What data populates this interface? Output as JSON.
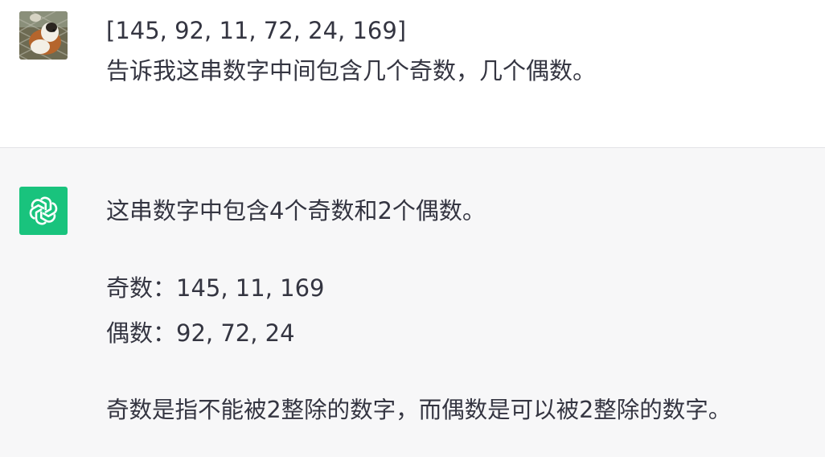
{
  "user_message": {
    "line1": "[145, 92, 11, 72, 24, 169]",
    "line2": "告诉我这串数字中间包含几个奇数，几个偶数。"
  },
  "assistant_message": {
    "summary": "这串数字中包含4个奇数和2个偶数。",
    "odd_line": "奇数：145, 11, 169",
    "even_line": "偶数：92, 72, 24",
    "explanation": "奇数是指不能被2整除的数字，而偶数是可以被2整除的数字。"
  },
  "colors": {
    "bot_avatar_bg": "#19c37d",
    "assistant_bg": "#f7f7f8",
    "text": "#343541"
  },
  "icons": {
    "user_avatar": "guinea-pig-photo",
    "bot_avatar": "openai-logo-icon"
  }
}
